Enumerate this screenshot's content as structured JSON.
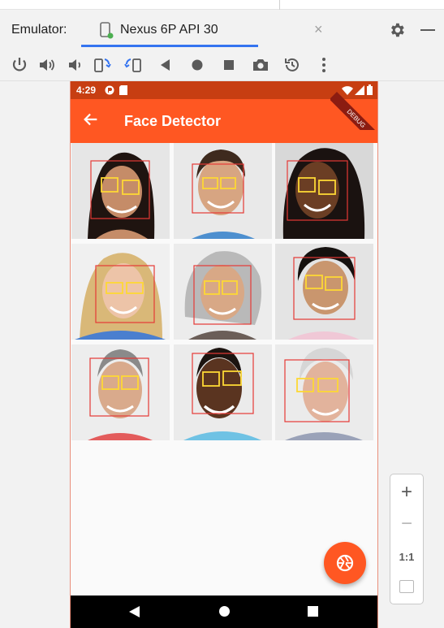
{
  "emulator": {
    "label": "Emulator:",
    "tab_label": "Nexus 6P API 30",
    "tab_close": "×",
    "accent": "#3574f0"
  },
  "toolbar": {
    "icons": [
      "power-icon",
      "volume-up-icon",
      "volume-down-icon",
      "rotate-left-icon",
      "rotate-right-icon",
      "back-icon",
      "home-icon",
      "overview-icon",
      "camera-icon",
      "snapshot-icon",
      "more-icon"
    ]
  },
  "device": {
    "status_time": "4:29",
    "app_title": "Face Detector",
    "debug_banner": "DEBUG",
    "primary_color": "#ff5722",
    "status_color": "#c73e12"
  },
  "zoom": {
    "plus": "+",
    "minus": "−",
    "one_to_one": "1:1"
  }
}
